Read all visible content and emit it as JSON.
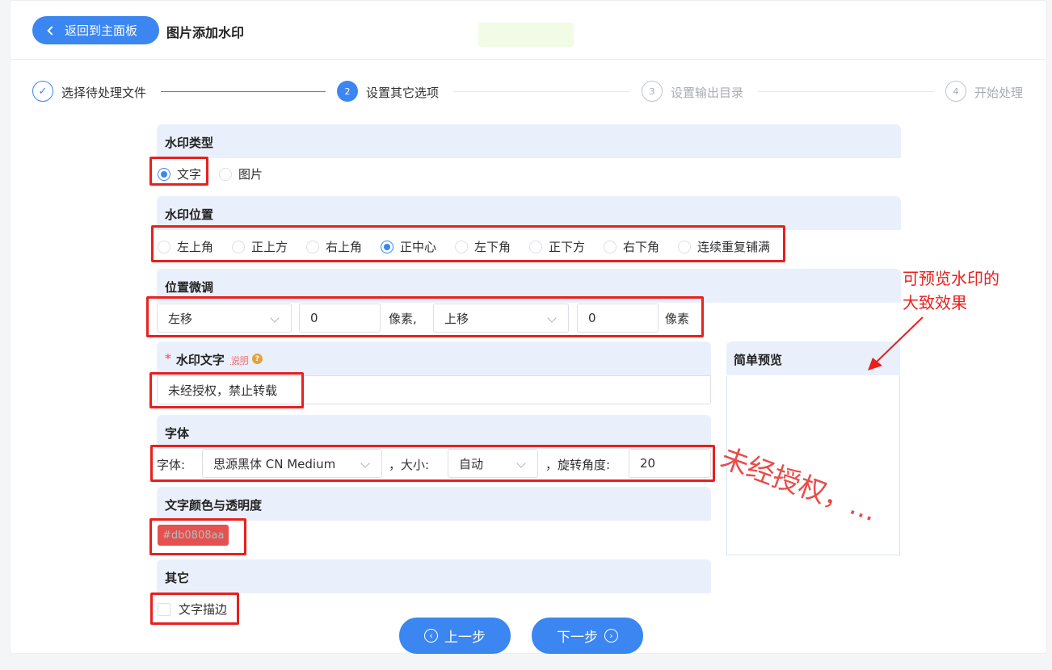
{
  "header": {
    "back_label": "返回到主面板",
    "title": "图片添加水印"
  },
  "steps": [
    {
      "num": "✓",
      "label": "选择待处理文件",
      "state": "done"
    },
    {
      "num": "2",
      "label": "设置其它选项",
      "state": "active"
    },
    {
      "num": "3",
      "label": "设置输出目录",
      "state": "pending"
    },
    {
      "num": "4",
      "label": "开始处理",
      "state": "pending"
    }
  ],
  "watermark_type": {
    "title": "水印类型",
    "options": [
      "文字",
      "图片"
    ],
    "selected": "文字"
  },
  "watermark_position": {
    "title": "水印位置",
    "options": [
      "左上角",
      "正上方",
      "右上角",
      "正中心",
      "左下角",
      "正下方",
      "右下角",
      "连续重复铺满"
    ],
    "selected": "正中心"
  },
  "fine_tune": {
    "title": "位置微调",
    "h_dir": "左移",
    "h_value": "0",
    "h_unit": "像素,",
    "v_dir": "上移",
    "v_value": "0",
    "v_unit": "像素"
  },
  "watermark_text": {
    "required_mark": "*",
    "title": "水印文字",
    "help_link": "说明",
    "help_icon": "?",
    "value": "未经授权，禁止转载"
  },
  "font": {
    "title": "字体",
    "font_label": "字体:",
    "font_value": "思源黑体 CN Medium",
    "size_label": "，大小:",
    "size_value": "自动",
    "rotate_label": "，旋转角度:",
    "rotate_value": "20"
  },
  "color": {
    "title": "文字颜色与透明度",
    "value": "#db0808aa",
    "hex": "#db0808"
  },
  "other": {
    "title": "其它",
    "stroke_label": "文字描边"
  },
  "preview": {
    "title": "简单预览",
    "sample": "未经授权，..."
  },
  "annotation": {
    "line1": "可预览水印的",
    "line2": "大致效果"
  },
  "nav": {
    "prev": "上一步",
    "next": "下一步"
  }
}
